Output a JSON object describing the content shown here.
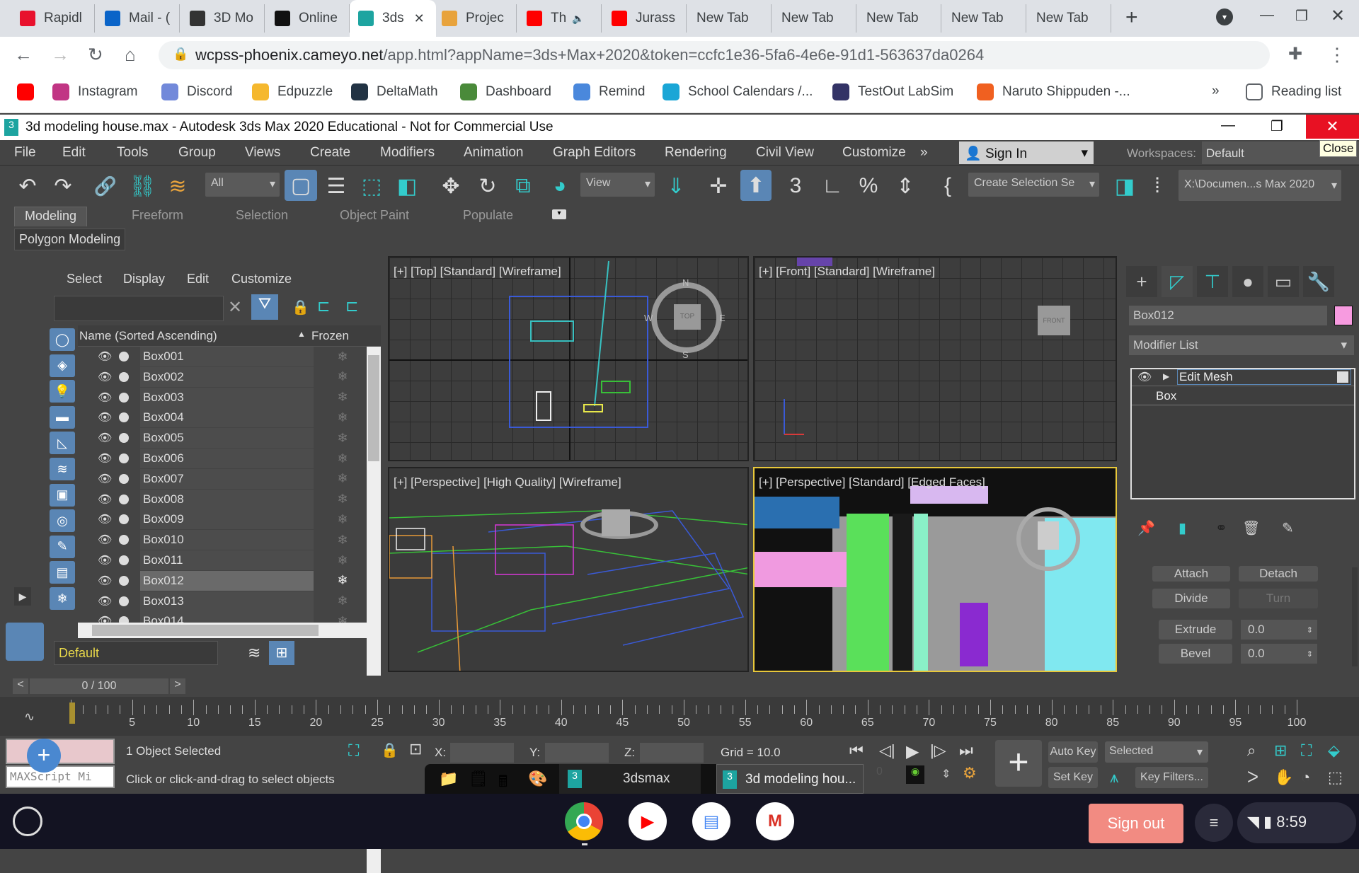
{
  "browser": {
    "tabs": [
      {
        "label": "Rapidl",
        "icon": "rapid-icon",
        "color": "#e8112d"
      },
      {
        "label": "Mail - (",
        "icon": "outlook-icon",
        "color": "#0a64c8"
      },
      {
        "label": "3D Mo",
        "icon": "contact-icon",
        "color": "#333333"
      },
      {
        "label": "Online",
        "icon": "play-outline-icon",
        "color": "#111111"
      },
      {
        "label": "3ds",
        "icon": "3dsmax-icon",
        "color": "#1da4a0",
        "active": true
      },
      {
        "label": "Projec",
        "icon": "character-icon",
        "color": "#e8a33c"
      },
      {
        "label": "Th",
        "icon": "youtube-icon",
        "color": "#ff0000",
        "audio": true
      },
      {
        "label": "Jurass",
        "icon": "youtube-icon",
        "color": "#ff0000"
      },
      {
        "label": "New Tab"
      },
      {
        "label": "New Tab"
      },
      {
        "label": "New Tab"
      },
      {
        "label": "New Tab"
      },
      {
        "label": "New Tab"
      }
    ],
    "url_host": "wcpss-phoenix.cameyo.net",
    "url_rest": "/app.html?appName=3ds+Max+2020&token=ccfc1e36-5fa6-4e6e-91d1-563637da0264",
    "bookmarks": [
      {
        "label": "",
        "color": "#ff0000"
      },
      {
        "label": "Instagram",
        "color": "#c13584"
      },
      {
        "label": "Discord",
        "color": "#7289da"
      },
      {
        "label": "Edpuzzle",
        "color": "#f5b82e"
      },
      {
        "label": "DeltaMath",
        "color": "#223344"
      },
      {
        "label": "Dashboard",
        "color": "#4a8a3a"
      },
      {
        "label": "Remind",
        "color": "#4a88dc"
      },
      {
        "label": "School Calendars /...",
        "color": "#1aa6d6"
      },
      {
        "label": "TestOut LabSim",
        "color": "#333366"
      },
      {
        "label": "Naruto Shippuden -...",
        "color": "#f06020"
      }
    ],
    "more_bookmarks": "»",
    "reading_list": "Reading list"
  },
  "app": {
    "title": "3d modeling house.max - Autodesk 3ds Max 2020 Educational - Not for Commercial Use",
    "close_tooltip": "Close",
    "menus": [
      "File",
      "Edit",
      "Tools",
      "Group",
      "Views",
      "Create",
      "Modifiers",
      "Animation",
      "Graph Editors",
      "Rendering",
      "Civil View",
      "Customize"
    ],
    "menu_overflow": "»",
    "sign_in": "Sign In",
    "workspaces_label": "Workspaces:",
    "workspace_value": "Default",
    "toolbar": {
      "selection_filter": "All",
      "ref_coord": "View",
      "selection_set": "Create Selection Se",
      "project_path": "X:\\Documen...s Max 2020"
    },
    "ribbon_tabs": [
      "Modeling",
      "Freeform",
      "Selection",
      "Object Paint",
      "Populate"
    ],
    "ribbon_sub": "Polygon Modeling",
    "accent": "#5a86b5"
  },
  "explorer": {
    "menus": [
      "Select",
      "Display",
      "Edit",
      "Customize"
    ],
    "search_placeholder": "",
    "col_name": "Name (Sorted Ascending)",
    "col_sort": "▲",
    "col_frozen": "Frozen",
    "rows": [
      "Box001",
      "Box002",
      "Box003",
      "Box004",
      "Box005",
      "Box006",
      "Box007",
      "Box008",
      "Box009",
      "Box010",
      "Box011",
      "Box012",
      "Box013",
      "Box014"
    ],
    "selected": "Box012",
    "layer": "Default"
  },
  "viewports": {
    "top": "[+] [Top] [Standard] [Wireframe]",
    "front": "[+] [Front] [Standard] [Wireframe]",
    "persp1": "[+] [Perspective] [High Quality] [Wireframe]",
    "persp2": "[+] [Perspective] [Standard] [Edged Faces]",
    "viewcube_top": "TOP",
    "viewcube_front": "FRONT",
    "compass": [
      "N",
      "E",
      "S",
      "W"
    ]
  },
  "command_panel": {
    "object_name": "Box012",
    "object_color": "#f79be0",
    "modifier_list": "Modifier List",
    "stack": [
      "Edit Mesh",
      "Box"
    ],
    "buttons": {
      "attach": "Attach",
      "detach": "Detach",
      "divide": "Divide",
      "turn": "Turn",
      "extrude": "Extrude",
      "bevel": "Bevel"
    },
    "extrude_value": "0.0",
    "bevel_value": "0.0"
  },
  "timeline": {
    "frame": "0 / 100",
    "current": 0,
    "end": 100,
    "labels": [
      5,
      10,
      15,
      20,
      25,
      30,
      35,
      40,
      45,
      50,
      55,
      60,
      65,
      70,
      75,
      80,
      85,
      90,
      95,
      100
    ]
  },
  "status": {
    "selected": "1 Object Selected",
    "prompt": "Click or click-and-drag to select objects",
    "maxscript": "MAXScript Mi",
    "x_label": "X:",
    "y_label": "Y:",
    "z_label": "Z:",
    "grid": "Grid = 10.0",
    "auto_key": "Auto Key",
    "set_key": "Set Key",
    "key_mode": "Selected",
    "key_filters": "Key Filters...",
    "frame_field": "0"
  },
  "windows_taskbar": {
    "app1": "3dsmax",
    "app2": "3d modeling hou..."
  },
  "shelf": {
    "sign_out": "Sign out",
    "time": "8:59"
  }
}
